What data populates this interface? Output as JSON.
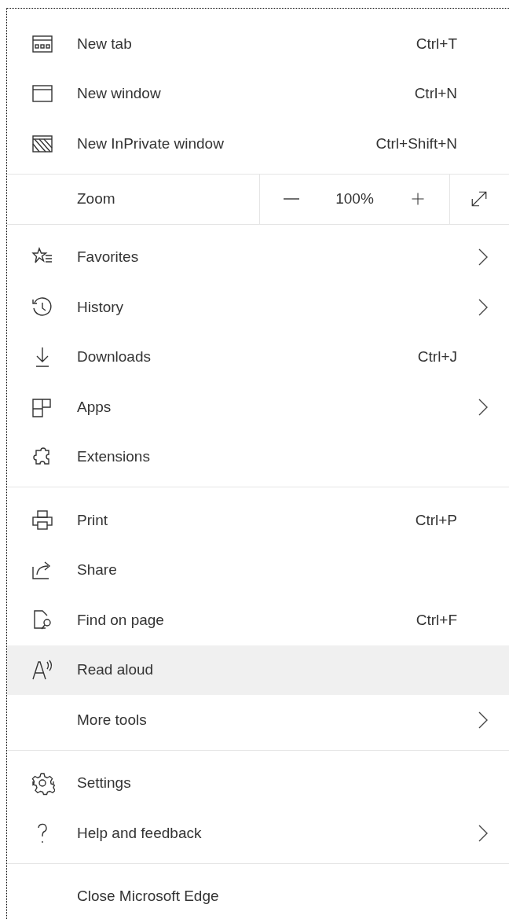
{
  "menu": {
    "sections": [
      {
        "items": [
          {
            "kind": "command",
            "label": "New tab",
            "shortcut": "Ctrl+T",
            "submenu": false,
            "selected": false
          },
          {
            "kind": "command",
            "label": "New window",
            "shortcut": "Ctrl+N",
            "submenu": false,
            "selected": false
          },
          {
            "kind": "command",
            "label": "New InPrivate window",
            "shortcut": "Ctrl+Shift+N",
            "submenu": false,
            "selected": false
          }
        ]
      },
      {
        "items": [
          {
            "kind": "zoom",
            "label": "Zoom",
            "value": "100%"
          }
        ]
      },
      {
        "items": [
          {
            "kind": "command",
            "label": "Favorites",
            "submenu": true,
            "selected": false
          },
          {
            "kind": "command",
            "label": "History",
            "submenu": true,
            "selected": false
          },
          {
            "kind": "command",
            "label": "Downloads",
            "shortcut": "Ctrl+J",
            "submenu": false,
            "selected": false
          },
          {
            "kind": "command",
            "label": "Apps",
            "submenu": true,
            "selected": false
          },
          {
            "kind": "command",
            "label": "Extensions",
            "submenu": false,
            "selected": false
          }
        ]
      },
      {
        "items": [
          {
            "kind": "command",
            "label": "Print",
            "shortcut": "Ctrl+P",
            "submenu": false,
            "selected": false
          },
          {
            "kind": "command",
            "label": "Share",
            "submenu": false,
            "selected": false
          },
          {
            "kind": "command",
            "label": "Find on page",
            "shortcut": "Ctrl+F",
            "submenu": false,
            "selected": false
          },
          {
            "kind": "command",
            "label": "Read aloud",
            "submenu": false,
            "selected": true
          },
          {
            "kind": "command",
            "label": "More tools",
            "submenu": true,
            "selected": false
          }
        ]
      },
      {
        "items": [
          {
            "kind": "command",
            "label": "Settings",
            "submenu": false,
            "selected": false
          },
          {
            "kind": "command",
            "label": "Help and feedback",
            "submenu": true,
            "selected": false
          }
        ]
      },
      {
        "items": [
          {
            "kind": "command",
            "label": "Close Microsoft Edge",
            "submenu": false,
            "selected": false
          }
        ]
      }
    ]
  }
}
